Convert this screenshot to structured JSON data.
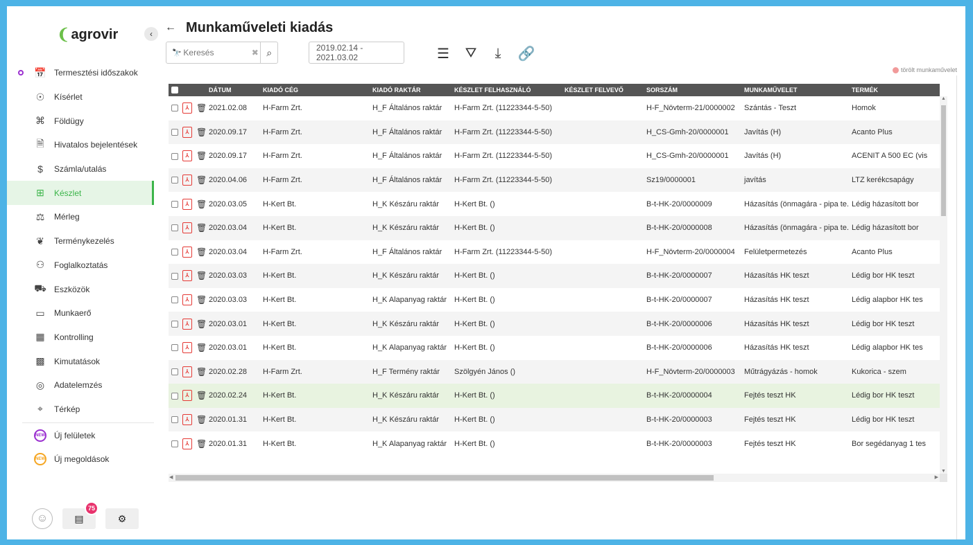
{
  "sidebar": {
    "logo": "agrovir",
    "items": [
      {
        "label": "Termesztési időszakok",
        "icon": "calendar-plant-icon"
      },
      {
        "label": "Kísérlet",
        "icon": "experiment-icon"
      },
      {
        "label": "Földügy",
        "icon": "land-icon"
      },
      {
        "label": "Hivatalos bejelentések",
        "icon": "document-icon"
      },
      {
        "label": "Számla/utalás",
        "icon": "invoice-icon"
      },
      {
        "label": "Készlet",
        "icon": "stock-icon"
      },
      {
        "label": "Mérleg",
        "icon": "scale-icon"
      },
      {
        "label": "Terménykezelés",
        "icon": "crop-icon"
      },
      {
        "label": "Foglalkoztatás",
        "icon": "employment-icon"
      },
      {
        "label": "Eszközök",
        "icon": "tractor-icon"
      },
      {
        "label": "Munkaerő",
        "icon": "id-card-icon"
      },
      {
        "label": "Kontrolling",
        "icon": "controlling-icon"
      },
      {
        "label": "Kimutatások",
        "icon": "report-icon"
      },
      {
        "label": "Adatelemzés",
        "icon": "analytics-icon"
      },
      {
        "label": "Térkép",
        "icon": "map-icon"
      }
    ],
    "new_items": [
      {
        "label": "Új felületek",
        "badge": "NEW"
      },
      {
        "label": "Új megoldások",
        "badge": "NEW"
      }
    ],
    "message_count": "75"
  },
  "header": {
    "title": "Munkaműveleti kiadás",
    "search_placeholder": "Keresés",
    "date_range": "2019.02.14 - 2021.03.02",
    "legend": "törölt munkaművelet"
  },
  "table": {
    "columns": [
      "DÁTUM",
      "KIADÓ CÉG",
      "KIADÓ RAKTÁR",
      "KÉSZLET FELHASZNÁLÓ",
      "KÉSZLET FELVEVŐ",
      "SORSZÁM",
      "MUNKAMŰVELET",
      "TERMÉK"
    ],
    "rows": [
      [
        "2021.02.08",
        "H-Farm Zrt.",
        "H_F Általános raktár",
        "H-Farm Zrt. (11223344-5-50)",
        "",
        "H-F_Növterm-21/0000002",
        "Szántás - Teszt",
        "Homok"
      ],
      [
        "2020.09.17",
        "H-Farm Zrt.",
        "H_F Általános raktár",
        "H-Farm Zrt. (11223344-5-50)",
        "",
        "H_CS-Gmh-20/0000001",
        "Javítás (H)",
        "Acanto Plus"
      ],
      [
        "2020.09.17",
        "H-Farm Zrt.",
        "H_F Általános raktár",
        "H-Farm Zrt. (11223344-5-50)",
        "",
        "H_CS-Gmh-20/0000001",
        "Javítás (H)",
        "ACENIT A 500 EC (vis"
      ],
      [
        "2020.04.06",
        "H-Farm Zrt.",
        "H_F Általános raktár",
        "H-Farm Zrt. (11223344-5-50)",
        "",
        "Sz19/0000001",
        "javítás",
        "LTZ kerékcsapágy"
      ],
      [
        "2020.03.05",
        "H-Kert Bt.",
        "H_K Készáru raktár",
        "H-Kert Bt. ()",
        "",
        "B-t-HK-20/0000009",
        "Házasítás (önmagára - pipa te...",
        "Lédig házasított bor"
      ],
      [
        "2020.03.04",
        "H-Kert Bt.",
        "H_K Készáru raktár",
        "H-Kert Bt. ()",
        "",
        "B-t-HK-20/0000008",
        "Házasítás (önmagára - pipa te...",
        "Lédig házasított bor"
      ],
      [
        "2020.03.04",
        "H-Farm Zrt.",
        "H_F Általános raktár",
        "H-Farm Zrt. (11223344-5-50)",
        "",
        "H-F_Növterm-20/0000004",
        "Felületpermetezés",
        "Acanto Plus"
      ],
      [
        "2020.03.03",
        "H-Kert Bt.",
        "H_K Készáru raktár",
        "H-Kert Bt. ()",
        "",
        "B-t-HK-20/0000007",
        "Házasítás HK teszt",
        "Lédig bor HK teszt"
      ],
      [
        "2020.03.03",
        "H-Kert Bt.",
        "H_K Alapanyag raktár",
        "H-Kert Bt. ()",
        "",
        "B-t-HK-20/0000007",
        "Házasítás HK teszt",
        "Lédig alapbor HK tes"
      ],
      [
        "2020.03.01",
        "H-Kert Bt.",
        "H_K Készáru raktár",
        "H-Kert Bt. ()",
        "",
        "B-t-HK-20/0000006",
        "Házasítás HK teszt",
        "Lédig bor HK teszt"
      ],
      [
        "2020.03.01",
        "H-Kert Bt.",
        "H_K Alapanyag raktár",
        "H-Kert Bt. ()",
        "",
        "B-t-HK-20/0000006",
        "Házasítás HK teszt",
        "Lédig alapbor HK tes"
      ],
      [
        "2020.02.28",
        "H-Farm Zrt.",
        "H_F Termény raktár",
        "Szölgyén János ()",
        "",
        "H-F_Növterm-20/0000003",
        "Műtrágyázás - homok",
        "Kukorica - szem"
      ],
      [
        "2020.02.24",
        "H-Kert Bt.",
        "H_K Készáru raktár",
        "H-Kert Bt. ()",
        "",
        "B-t-HK-20/0000004",
        "Fejtés teszt HK",
        "Lédig bor HK teszt"
      ],
      [
        "2020.01.31",
        "H-Kert Bt.",
        "H_K Készáru raktár",
        "H-Kert Bt. ()",
        "",
        "B-t-HK-20/0000003",
        "Fejtés teszt HK",
        "Lédig bor HK teszt"
      ],
      [
        "2020.01.31",
        "H-Kert Bt.",
        "H_K Alapanyag raktár",
        "H-Kert Bt. ()",
        "",
        "B-t-HK-20/0000003",
        "Fejtés teszt HK",
        "Bor segédanyag 1 tes"
      ]
    ],
    "hover_row": 12
  },
  "colors": {
    "accent": "#3cb54a",
    "frame": "#4db3e6",
    "header": "#555555",
    "pdf": "#e53935"
  }
}
